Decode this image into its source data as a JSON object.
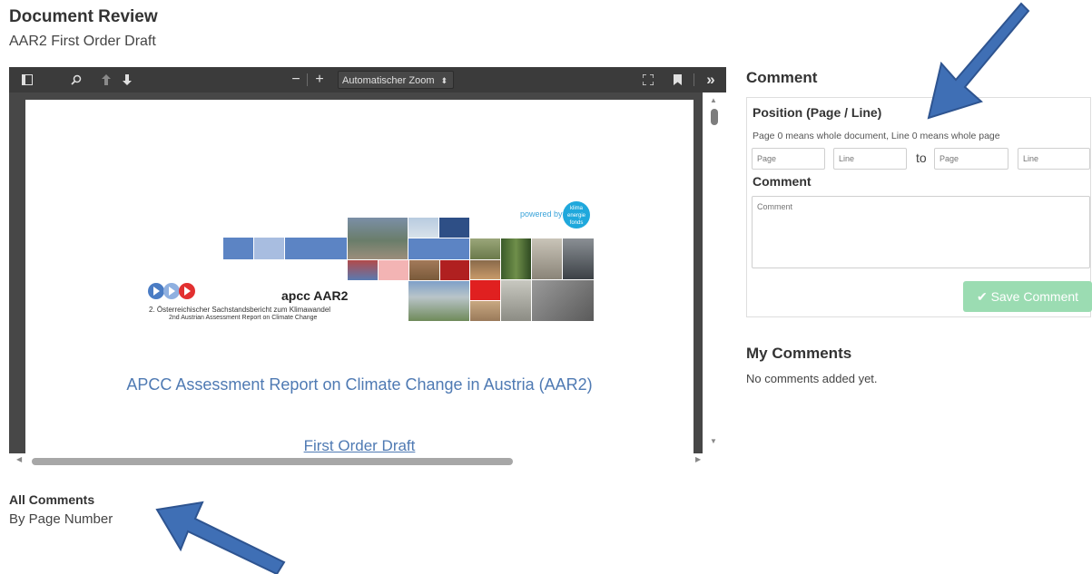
{
  "page": {
    "title": "Document Review",
    "subtitle": "AAR2 First Order Draft"
  },
  "viewer": {
    "toolbar": {
      "sidebar_icon": "sidebar-toggle-icon",
      "search_icon": "search-icon",
      "prev_icon": "arrow-up-icon",
      "next_icon": "arrow-down-icon",
      "zoom_out": "−",
      "zoom_in": "+",
      "zoom_value": "Automatischer Zoom",
      "fullscreen_icon": "fullscreen-icon",
      "bookmark_icon": "bookmark-icon",
      "more_label": "»"
    },
    "document": {
      "powered_by": "powered by",
      "fund_logo_text": "klima energie fonds",
      "apcc_label": "apcc AAR2",
      "subtitle_de": "2. Österreichischer Sachstandsbericht zum Klimawandel",
      "subtitle_en": "2nd Austrian Assessment Report on Climate Change",
      "heading": "APCC Assessment Report on Climate Change in Austria (AAR2)",
      "link": "First Order Draft"
    }
  },
  "comment_form": {
    "heading": "Comment",
    "position_label": "Position (Page / Line)",
    "hint": "Page 0 means whole document, Line 0 means whole page",
    "from_page_placeholder": "Page",
    "from_line_placeholder": "Line",
    "to_label": "to",
    "to_page_placeholder": "Page",
    "to_line_placeholder": "Line",
    "comment_label": "Comment",
    "comment_placeholder": "Comment",
    "save_label": "Save Comment"
  },
  "my_comments": {
    "heading": "My Comments",
    "empty_text": "No comments added yet."
  },
  "all_comments": {
    "heading": "All Comments",
    "subheading": "By Page Number"
  },
  "colors": {
    "accent": "#4f7ab3",
    "save_button": "#9bdcb2",
    "annotation_arrow": "#3f6fb5"
  }
}
